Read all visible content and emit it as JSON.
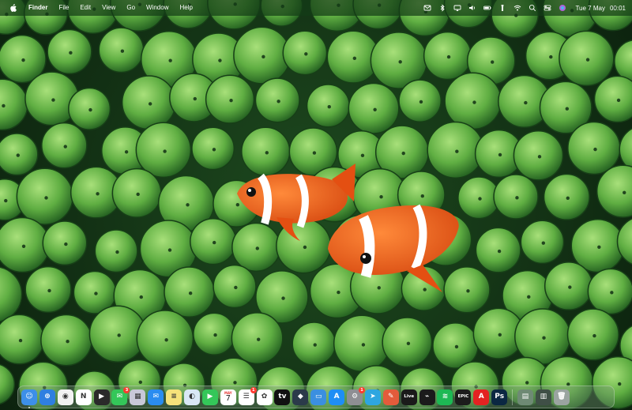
{
  "menubar": {
    "app_name": "Finder",
    "menus": [
      "File",
      "Edit",
      "View",
      "Go",
      "Window",
      "Help"
    ],
    "status_icons": [
      "mail-icon",
      "bluetooth-icon",
      "screen-mirroring-icon",
      "volume-icon",
      "battery-icon",
      "flashlight-icon",
      "wifi-icon",
      "spotlight-search-icon",
      "control-center-icon",
      "siri-icon"
    ],
    "date": "Tue 7 May",
    "time": "00:01"
  },
  "dock": {
    "apps": [
      {
        "name": "Finder",
        "icon": "finder-icon",
        "bg": "#3d8fe8",
        "glyph": "☺",
        "running": true
      },
      {
        "name": "Safari",
        "icon": "safari-icon",
        "bg": "#2f7fe0",
        "glyph": "⊕",
        "running": false
      },
      {
        "name": "Google Chrome",
        "icon": "chrome-icon",
        "bg": "#f2f2f2",
        "glyph": "◉",
        "running": false
      },
      {
        "name": "Notion",
        "icon": "notion-icon",
        "bg": "#ffffff",
        "glyph": "N",
        "running": false
      },
      {
        "name": "Infuse",
        "icon": "infuse-icon",
        "bg": "#2a2a2a",
        "glyph": "▶",
        "running": false
      },
      {
        "name": "Messages",
        "icon": "messages-icon",
        "bg": "#34c759",
        "glyph": "✉",
        "badge": "3",
        "running": false
      },
      {
        "name": "Launchpad",
        "icon": "launchpad-icon",
        "bg": "#c8c8d8",
        "glyph": "▦",
        "running": false
      },
      {
        "name": "Mail",
        "icon": "mail-app-icon",
        "bg": "#2a8cf0",
        "glyph": "✉",
        "running": false
      },
      {
        "name": "Notes",
        "icon": "notes-icon",
        "bg": "#f6e27a",
        "glyph": "≡",
        "running": false
      },
      {
        "name": "Preview",
        "icon": "preview-icon",
        "bg": "#d9e8f5",
        "glyph": "◐",
        "running": false
      },
      {
        "name": "FaceTime",
        "icon": "facetime-icon",
        "bg": "#34c759",
        "glyph": "▶",
        "running": false
      },
      {
        "name": "Calendar",
        "icon": "calendar-icon",
        "bg": "#ffffff",
        "glyph": "7",
        "cal_day": "MAY",
        "running": false
      },
      {
        "name": "Reminders",
        "icon": "reminders-icon",
        "bg": "#ffffff",
        "glyph": "☰",
        "badge": "1",
        "running": false
      },
      {
        "name": "Photos",
        "icon": "photos-icon",
        "bg": "#ffffff",
        "glyph": "✿",
        "running": false
      },
      {
        "name": "Apple TV",
        "icon": "apple-tv-icon",
        "bg": "#111111",
        "glyph": "tv",
        "running": false
      },
      {
        "name": "DaVinci Resolve",
        "icon": "davinci-icon",
        "bg": "#2b3a4a",
        "glyph": "◆",
        "running": false
      },
      {
        "name": "Keynote",
        "icon": "keynote-icon",
        "bg": "#3b8fe0",
        "glyph": "▭",
        "running": false
      },
      {
        "name": "App Store",
        "icon": "app-store-icon",
        "bg": "#1e8ef5",
        "glyph": "A",
        "running": false
      },
      {
        "name": "System Settings",
        "icon": "system-settings-icon",
        "bg": "#8e8e93",
        "glyph": "⚙",
        "badge": "1",
        "running": false
      },
      {
        "name": "Telegram",
        "icon": "telegram-icon",
        "bg": "#2ea6e0",
        "glyph": "➤",
        "running": false
      },
      {
        "name": "Stickies",
        "icon": "stickies-icon",
        "bg": "#e35b3b",
        "glyph": "✎",
        "running": false
      },
      {
        "name": "Live",
        "icon": "ableton-live-icon",
        "bg": "#1a1a1a",
        "glyph": "Live",
        "running": false
      },
      {
        "name": "Activity Monitor",
        "icon": "activity-monitor-icon",
        "bg": "#1b1b1b",
        "glyph": "⌁",
        "running": false
      },
      {
        "name": "Spotify",
        "icon": "spotify-icon",
        "bg": "#1db954",
        "glyph": "≋",
        "running": false
      },
      {
        "name": "Epic Games",
        "icon": "epic-games-icon",
        "bg": "#1c1c1c",
        "glyph": "EPIC",
        "running": false
      },
      {
        "name": "Acrobat",
        "icon": "acrobat-icon",
        "bg": "#e32222",
        "glyph": "A",
        "running": false
      },
      {
        "name": "Photoshop",
        "icon": "photoshop-icon",
        "bg": "#0b2742",
        "glyph": "Ps",
        "running": false
      }
    ],
    "stack": [
      {
        "name": "Desktop Folder",
        "icon": "desktop-folder-icon",
        "bg": "#6e8a74",
        "glyph": "▤"
      },
      {
        "name": "Downloads",
        "icon": "downloads-stack-icon",
        "bg": "#3f4f46",
        "glyph": "▥"
      },
      {
        "name": "Trash",
        "icon": "trash-icon",
        "bg": "#9aa4a0",
        "glyph": "🗑"
      }
    ]
  },
  "colors": {
    "menubar_bg": "#14481a",
    "wallpaper_base": "#1e4a1f",
    "anemone_light": "#8fd36a",
    "anemone_dark": "#2f7d2a",
    "clownfish_orange": "#f05a14"
  }
}
